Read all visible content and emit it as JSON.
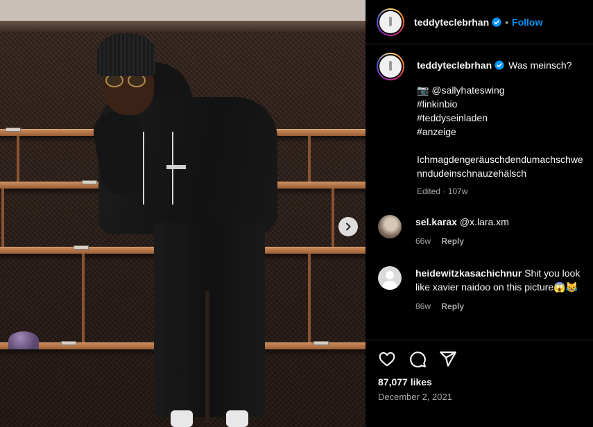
{
  "post": {
    "author": "teddyteclebrhan",
    "follow_label": "Follow",
    "dot": "•",
    "caption_first": "Was meinsch?",
    "caption_lines": [
      "📷 @sallyhateswing",
      "#linkinbio",
      "#teddyseinladen",
      "#anzeige",
      "",
      "Ichmagdengeräuschdendumachschwe",
      "nndudeinschnauzehälsch"
    ],
    "edited_meta": "Edited · 107w",
    "likes": "87,077 likes",
    "date": "December 2, 2021"
  },
  "comments": [
    {
      "user": "sel.karax",
      "text": "@x.lara.xm",
      "age": "66w",
      "reply": "Reply"
    },
    {
      "user": "heidewitzkasachichnur",
      "text": "Shit you look like xavier naidoo on this picture😱😹",
      "age": "86w",
      "reply": "Reply"
    }
  ],
  "icons": {
    "verified": "verified-badge-icon",
    "like": "heart-icon",
    "comment": "comment-icon",
    "share": "share-icon",
    "next": "chevron-right-icon"
  },
  "colors": {
    "accent": "#0095f6",
    "background": "#000000",
    "muted": "#a8a8a8"
  }
}
